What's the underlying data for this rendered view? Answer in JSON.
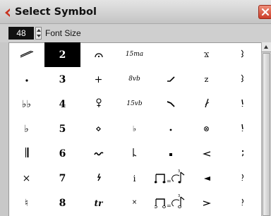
{
  "window": {
    "title": "Select Symbol",
    "close_icon": "close-icon",
    "app_icon": "cubase-logo-icon"
  },
  "toolbar": {
    "font_size_value": "48",
    "font_size_label": "Font Size"
  },
  "symbol_grid": {
    "selected": "2",
    "rows": [
      [
        "slash-icon",
        "2",
        "fermata-icon",
        "15ma",
        "",
        "Ϫ",
        "nailed-right-icon"
      ],
      [
        "dot-icon",
        "3",
        "+",
        "8vb",
        "bend-icon",
        "z",
        "nailed-right-icon"
      ],
      [
        "♭♭",
        "4",
        "fingering-icon",
        "15vb",
        "fall-icon",
        "slashed-stem-icon",
        "nailed-right-icon"
      ],
      [
        "♭",
        "5",
        "⋄",
        "♭",
        "dot-icon",
        "⊗",
        "nailed-right-icon"
      ],
      [
        "double-bar-icon",
        "6",
        "trill-wiggle-icon",
        "flag-icon",
        "square-dot-icon",
        "arrow-left-icon",
        "comma-icon"
      ],
      [
        "×",
        "7",
        "turn-icon",
        "i",
        "tuplet-one",
        "arrow-left-filled-icon",
        "nailed-right-icon"
      ],
      [
        "♮",
        "8",
        "tr",
        "×",
        "tuplet-two",
        "arrow-right-icon",
        "nailed-right-icon"
      ]
    ]
  },
  "tuplets": {
    "one": "= ",
    "two": "= "
  },
  "colors": {
    "selection": "#000000",
    "close_button": "#d9503a"
  }
}
